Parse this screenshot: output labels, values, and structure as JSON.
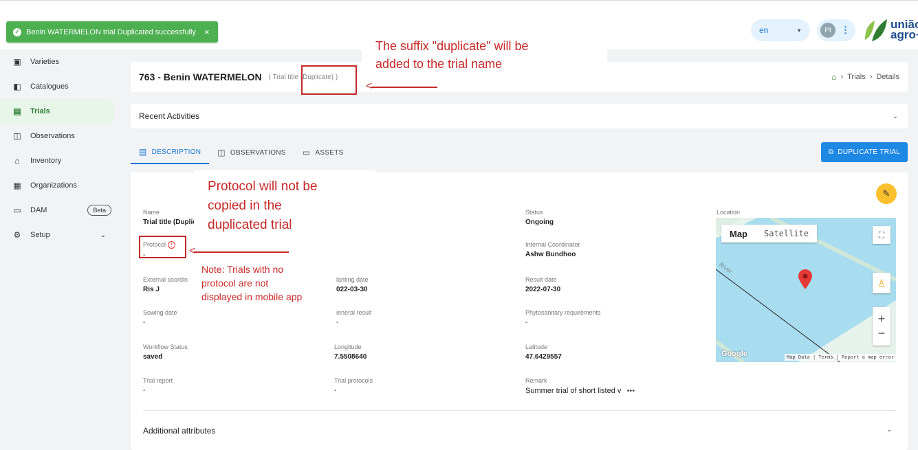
{
  "toast": {
    "message": "Benin WATERMELON trial Duplicated successfully",
    "close": "×"
  },
  "header": {
    "language": "en",
    "avatar_initials": "PI",
    "logo_line1": "união",
    "logo_line2": "agro+"
  },
  "sidebar": {
    "items": [
      {
        "label": "Varieties",
        "icon": "varieties-icon"
      },
      {
        "label": "Catalogues",
        "icon": "catalogue-icon"
      },
      {
        "label": "Trials",
        "icon": "trials-icon"
      },
      {
        "label": "Observations",
        "icon": "observations-icon"
      },
      {
        "label": "Inventory",
        "icon": "inventory-icon"
      },
      {
        "label": "Organizations",
        "icon": "organizations-icon"
      },
      {
        "label": "DAM",
        "icon": "folder-icon",
        "badge": "Beta"
      },
      {
        "label": "Setup",
        "icon": "gear-icon"
      }
    ]
  },
  "page": {
    "title": "763 - Benin WATERMELON",
    "subtitle": "( Trial title (Duplicate) )",
    "breadcrumb": [
      "Trials",
      "Details"
    ]
  },
  "recent": {
    "label": "Recent Activities"
  },
  "tabs": [
    "DESCRIPTION",
    "OBSERVATIONS",
    "ASSETS"
  ],
  "duplicate_button": "DUPLICATE TRIAL",
  "fields": {
    "name": {
      "label": "Name",
      "value": "Trial title (Duplica"
    },
    "protocol": {
      "label": "Protocol",
      "value": "-"
    },
    "external": {
      "label": "External coordin",
      "value": "Ris J"
    },
    "sowing": {
      "label": "Sowing date",
      "value": "-"
    },
    "workflow": {
      "label": "Workflow Status",
      "value": "saved"
    },
    "report": {
      "label": "Trial report",
      "value": "-"
    },
    "planting": {
      "label": "lanting date",
      "value": "022-03-30"
    },
    "general": {
      "label": "ieneral result",
      "value": "-"
    },
    "longitude": {
      "label": "Longitude",
      "value": "7.5508640"
    },
    "trial_protocols": {
      "label": "Trial protocols",
      "value": "-"
    },
    "status": {
      "label": "Status",
      "value": "Ongoing"
    },
    "internal": {
      "label": "Internal Coordinator",
      "value": "Ashw Bundhoo"
    },
    "result_date": {
      "label": "Result date",
      "value": "2022-07-30"
    },
    "phyto": {
      "label": "Phytosanitary requirements",
      "value": "-"
    },
    "latitude": {
      "label": "Latitude",
      "value": "47.6429557"
    },
    "remark": {
      "label": "Remark",
      "value": "Summer trial of short listed v ",
      "more": "•••"
    }
  },
  "map": {
    "label": "Location",
    "tab_map": "Map",
    "tab_satellite": "Satellite",
    "river_label": "River",
    "google": "Google",
    "footer": "Map Data | Terms | Report a map error"
  },
  "additional": {
    "label": "Additional attributes"
  },
  "annotations": {
    "suffix_note": [
      "The suffix \"duplicate\" will be",
      "added to the trial name"
    ],
    "protocol_note": [
      "Protocol will not be",
      "copied in the",
      "duplicated trial"
    ],
    "mobile_note": [
      "Note: Trials with no",
      "protocol are not",
      "displayed in mobile app"
    ]
  },
  "colors": {
    "accent": "#1976d2",
    "success": "#4caf50",
    "annotation": "#c62828",
    "active_nav": "#2e7d32"
  }
}
